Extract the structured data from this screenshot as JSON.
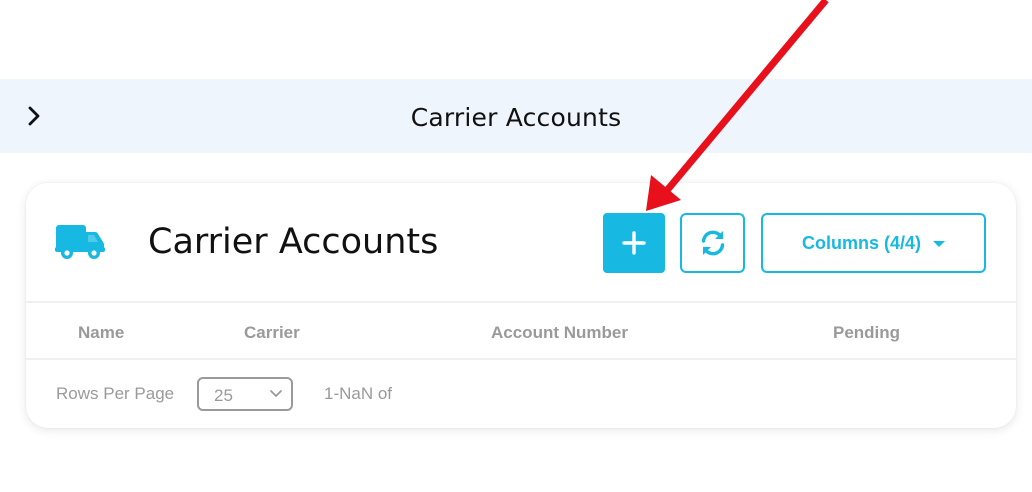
{
  "topbar": {
    "title": "Carrier Accounts",
    "expand_icon": "chevron-right-icon"
  },
  "card": {
    "icon": "truck-icon",
    "title": "Carrier Accounts",
    "buttons": {
      "add_icon": "plus-icon",
      "refresh_icon": "refresh-icon",
      "columns_label": "Columns (4/4)"
    },
    "table": {
      "columns": [
        "Name",
        "Carrier",
        "Account Number",
        "Pending"
      ],
      "rows": []
    },
    "pagination": {
      "rows_per_page_label": "Rows Per Page",
      "rows_per_page_value": "25",
      "range_text": "1-NaN of"
    }
  },
  "annotation": {
    "type": "red-arrow",
    "points_to": "add-button"
  },
  "colors": {
    "accent": "#17b9e2",
    "topbar_bg": "#eef5fc",
    "muted_text": "#9a9a9a",
    "arrow": "#e8101a"
  }
}
